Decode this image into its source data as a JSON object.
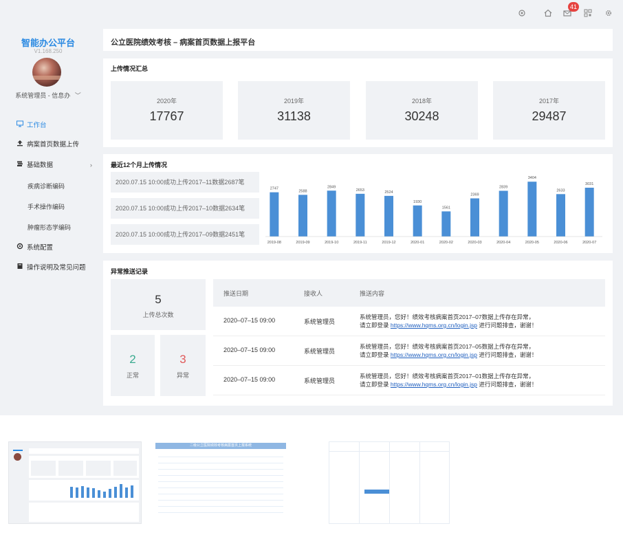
{
  "topbar": {
    "icons": [
      "settings-icon",
      "home-icon",
      "mail-icon",
      "qrcode-icon",
      "gear-icon"
    ],
    "mail_badge": "41"
  },
  "sidebar": {
    "brand": "智能办公平台",
    "version": "V1.168.250",
    "user": "系统管理员 - 信息办",
    "menu": [
      {
        "label": "工作台",
        "icon": "monitor-icon"
      },
      {
        "label": "病案首页数据上传",
        "icon": "upload-icon"
      },
      {
        "label": "基础数据",
        "icon": "database-icon"
      },
      {
        "label": "系统配置",
        "icon": "settings-icon"
      },
      {
        "label": "操作说明及常见问题",
        "icon": "book-icon"
      }
    ],
    "submenu": [
      "疾病诊断编码",
      "手术操作编码",
      "肿瘤形态学编码"
    ]
  },
  "header": {
    "title": "公立医院绩效考核 – 病案首页数据上报平台"
  },
  "summary": {
    "title": "上传情况汇总",
    "stats": [
      {
        "year": "2020年",
        "value": "17767"
      },
      {
        "year": "2019年",
        "value": "31138"
      },
      {
        "year": "2018年",
        "value": "30248"
      },
      {
        "year": "2017年",
        "value": "29487"
      }
    ]
  },
  "recent": {
    "title": "最近12个月上传情况",
    "logs": [
      "2020.07.15 10:00成功上传2017–11数据2687笔",
      "2020.07.15 10:00成功上传2017–10数据2634笔",
      "2020.07.15 10:00成功上传2017–09数据2451笔"
    ]
  },
  "chart_data": {
    "type": "bar",
    "categories": [
      "2019-08",
      "2019-09",
      "2019-10",
      "2019-11",
      "2019-12",
      "2020-01",
      "2020-02",
      "2020-03",
      "2020-04",
      "2020-05",
      "2020-06",
      "2020-07"
    ],
    "values": [
      2747,
      2588,
      2849,
      2653,
      2524,
      1930,
      1561,
      2369,
      2839,
      3404,
      2633,
      3031
    ],
    "ylim": [
      0,
      3500
    ],
    "grid": false,
    "color": "#4a8fd6"
  },
  "abnormal": {
    "title": "异常推送记录",
    "total_value": "5",
    "total_label": "上传总次数",
    "normal_value": "2",
    "normal_label": "正常",
    "abnormal_value": "3",
    "abnormal_label": "异常",
    "normal_color": "#3aaa8f",
    "abnormal_color": "#e05a5a",
    "headers": [
      "推送日期",
      "接收人",
      "推送内容"
    ],
    "rows": [
      {
        "date": "2020–07–15 09:00",
        "receiver": "系统管理员",
        "line1": "系统管理员，您好！绩效考核病案首页2017–07数据上传存在异常，",
        "prefix": "请立即登录 ",
        "link": "https://www.hqms.org.cn/login.jsp",
        "suffix": " 进行问题排查，谢谢！"
      },
      {
        "date": "2020–07–15 09:00",
        "receiver": "系统管理员",
        "line1": "系统管理员，您好！绩效考核病案首页2017–05数据上传存在异常，",
        "prefix": "请立即登录 ",
        "link": "https://www.hqms.org.cn/login.jsp",
        "suffix": " 进行问题排查，谢谢！"
      },
      {
        "date": "2020–07–15 09:00",
        "receiver": "系统管理员",
        "line1": "系统管理员，您好！绩效考核病案首页2017–01数据上传存在异常，",
        "prefix": "请立即登录 ",
        "link": "https://www.hqms.org.cn/login.jsp",
        "suffix": " 进行问题排查，谢谢！"
      }
    ]
  },
  "thumbnails": [
    {
      "name": "dashboard-thumbnail"
    },
    {
      "name": "system-table-thumbnail",
      "title": "二级公立医院绩效考核病案首页上报系统"
    },
    {
      "name": "flowchart-thumbnail"
    }
  ]
}
